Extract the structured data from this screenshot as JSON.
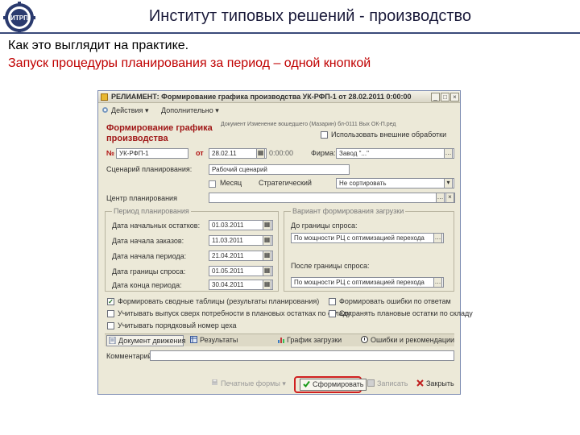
{
  "slide": {
    "title": "Институт типовых решений - производство",
    "logo_text": "ИТРП",
    "subtitle": "Как это выглядит на практике.",
    "caption": "Запуск процедуры планирования за период – одной кнопкой"
  },
  "window": {
    "title": "РЕЛИАМЕНТ: Формирование графика производства УК-РФП-1 от 28.02.2011 0:00:00",
    "toolbar": {
      "actions": "Действия",
      "more": "Дополнительно"
    },
    "header_info": "Документ Изменение вошедшего (Мазарин) бл-0111 Вых ОК-П.ред",
    "checkbox_external": "Использовать внешние обработки",
    "form_heading": "Формирование графика производства",
    "number_label": "№",
    "number_value": "УК-РФП-1",
    "date_label": "от",
    "date_value": "28.02.11",
    "time_value": "0:00:00",
    "firm_label": "Фирма:",
    "firm_value": "Завод \"...\"",
    "scenario_label": "Сценарий планирования:",
    "scenario_value": "Рабочий сценарий",
    "method_label": "Месяц",
    "method_value": "Стратегический",
    "sort_label": "",
    "sort_value": "Не сортировать",
    "center_label": "Центр планирования",
    "center_value": "",
    "period_group": {
      "title": "Период планирования",
      "rows": [
        {
          "label": "Дата начальных остатков:",
          "value": "01.03.2011"
        },
        {
          "label": "Дата начала заказов:",
          "value": "11.03.2011"
        },
        {
          "label": "Дата начала периода:",
          "value": "21.04.2011"
        },
        {
          "label": "Дата границы спроса:",
          "value": "01.05.2011"
        },
        {
          "label": "Дата конца периода:",
          "value": "30.04.2011"
        }
      ]
    },
    "variant_group": {
      "title": "Вариант формирования загрузки",
      "before_label": "До границы спроса:",
      "before_value": "По мощности РЦ с оптимизацией перехода",
      "after_label": "После границы спроса:",
      "after_value": "По мощности РЦ с оптимизацией перехода"
    },
    "checkboxes": [
      {
        "label": "Формировать сводные таблицы (результаты планирования)",
        "checked": true
      },
      {
        "label": "Учитывать выпуск сверх потребности в плановых остатках по складу",
        "checked": false
      },
      {
        "label": "Учитывать порядковый номер цеха",
        "checked": false
      }
    ],
    "checkbox_right": "Формировать ошибки по ответам",
    "checkbox_right2": "Сохранять плановые остатки по складу",
    "tabs": [
      {
        "label": "Документ движения",
        "icon": "doc-icon"
      },
      {
        "label": "Результаты",
        "icon": "table-icon"
      },
      {
        "label": "График загрузки",
        "icon": "chart-icon"
      },
      {
        "label": "Ошибки и рекомендации",
        "icon": "warning-icon"
      }
    ],
    "comment_label": "Комментарий",
    "comment_value": "",
    "buttons": {
      "print": "Печатные формы",
      "run": "Сформировать",
      "save": "Записать",
      "ok": "Закрыть"
    },
    "colors": {
      "highlight": "#d02020",
      "heading": "#a01818",
      "window_bg": "#ece9d8"
    }
  }
}
